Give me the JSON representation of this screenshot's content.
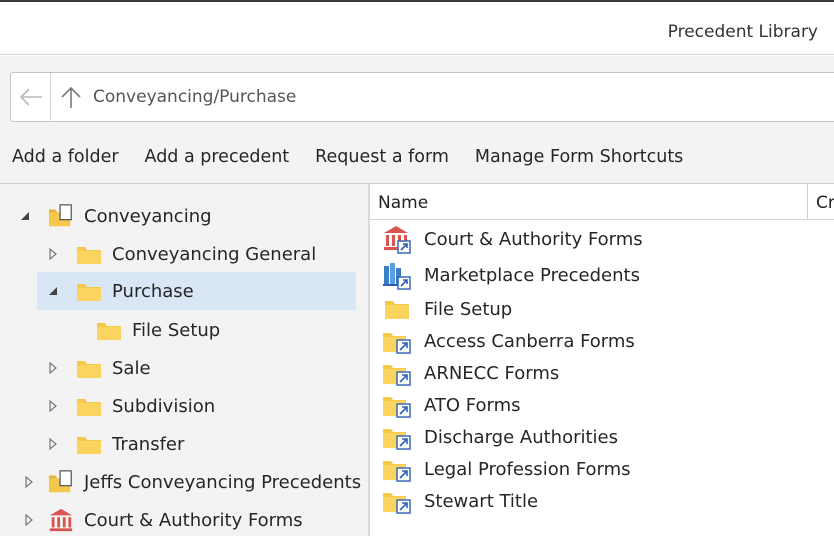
{
  "window": {
    "title": "Precedent Library"
  },
  "addressbar": {
    "path": "Conveyancing/Purchase"
  },
  "toolbar": {
    "items": [
      "Add a folder",
      "Add a precedent",
      "Request a form",
      "Manage Form Shortcuts"
    ]
  },
  "tree": {
    "nodes": [
      {
        "label": "Conveyancing",
        "icon": "folder-document-icon",
        "state": "expanded"
      },
      {
        "label": "Conveyancing General",
        "icon": "folder-icon",
        "state": "collapsed"
      },
      {
        "label": "Purchase",
        "icon": "folder-icon",
        "state": "expanded",
        "selected": true
      },
      {
        "label": "File Setup",
        "icon": "folder-icon",
        "state": "leaf"
      },
      {
        "label": "Sale",
        "icon": "folder-icon",
        "state": "collapsed"
      },
      {
        "label": "Subdivision",
        "icon": "folder-icon",
        "state": "collapsed"
      },
      {
        "label": "Transfer",
        "icon": "folder-icon",
        "state": "collapsed"
      },
      {
        "label": "Jeffs Conveyancing Precedents",
        "icon": "folder-document-icon",
        "state": "collapsed"
      },
      {
        "label": "Court & Authority Forms",
        "icon": "court-building-icon",
        "state": "collapsed"
      }
    ]
  },
  "list": {
    "columns": [
      "Name",
      "Cr"
    ],
    "rows": [
      {
        "name": "Court & Authority Forms",
        "icon": "court-shortcut-icon"
      },
      {
        "name": "Marketplace Precedents",
        "icon": "marketplace-shortcut-icon"
      },
      {
        "name": "File Setup",
        "icon": "folder-icon"
      },
      {
        "name": "Access Canberra Forms",
        "icon": "folder-shortcut-icon"
      },
      {
        "name": "ARNECC Forms",
        "icon": "folder-shortcut-icon"
      },
      {
        "name": "ATO Forms",
        "icon": "folder-shortcut-icon"
      },
      {
        "name": "Discharge Authorities",
        "icon": "folder-shortcut-icon"
      },
      {
        "name": "Legal Profession Forms",
        "icon": "folder-shortcut-icon"
      },
      {
        "name": "Stewart Title",
        "icon": "folder-shortcut-icon"
      }
    ]
  },
  "colors": {
    "selection": "#d8e6f5",
    "folder": "#f5c84c",
    "shortcut_arrow": "#2b5fb4",
    "court_icon": "#d9534f",
    "pane_bg": "#f3f3f3"
  }
}
